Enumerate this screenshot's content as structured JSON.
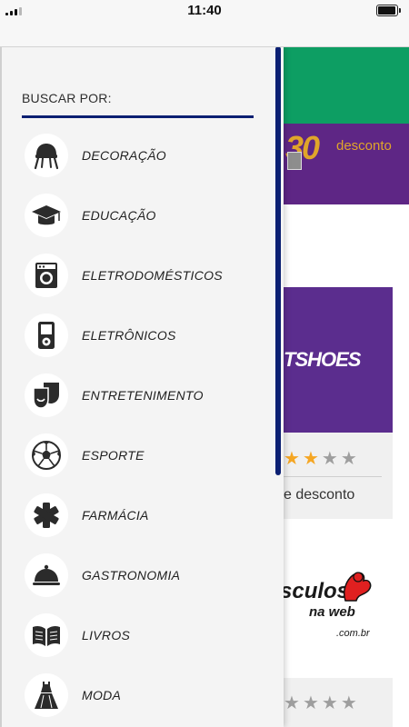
{
  "status_bar": {
    "time": "11:40"
  },
  "drawer": {
    "header": "BUSCAR POR:",
    "categories": [
      {
        "label": "DECORAÇÃO",
        "icon": "chair-icon"
      },
      {
        "label": "EDUCAÇÃO",
        "icon": "graduation-cap-icon"
      },
      {
        "label": "ELETRODOMÉSTICOS",
        "icon": "washing-machine-icon"
      },
      {
        "label": "ELETRÔNICOS",
        "icon": "media-player-icon"
      },
      {
        "label": "ENTRETENIMENTO",
        "icon": "theater-masks-icon"
      },
      {
        "label": "ESPORTE",
        "icon": "soccer-ball-icon"
      },
      {
        "label": "FARMÁCIA",
        "icon": "medical-cross-icon"
      },
      {
        "label": "GASTRONOMIA",
        "icon": "cloche-icon"
      },
      {
        "label": "LIVROS",
        "icon": "open-book-icon"
      },
      {
        "label": "MODA",
        "icon": "dress-icon"
      }
    ]
  },
  "background": {
    "promo_banner": {
      "digit": "30",
      "word": "desconto"
    },
    "store_cards": [
      {
        "logo_text": "TSHOES",
        "rating_filled": 2,
        "rating_total": 4,
        "discount_text": "e desconto"
      },
      {
        "logo_main": "sculos",
        "logo_sub": "na web",
        "logo_domain": ".com.br",
        "rating_filled": 0,
        "rating_total": 4
      }
    ]
  },
  "colors": {
    "accent_navy": "#0b1f72",
    "banner_green": "#0d9e63",
    "banner_purple": "#5e2685",
    "star_filled": "#f5a623",
    "star_empty": "#9e9e9e"
  }
}
